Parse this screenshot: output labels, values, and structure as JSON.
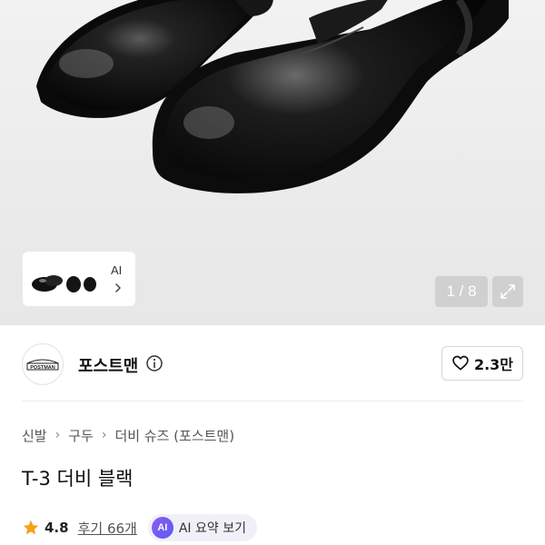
{
  "gallery": {
    "image_alt": "black derby shoes",
    "thumbnail_tag": "AI",
    "pager": "1 / 8"
  },
  "brand": {
    "name": "포스트맨",
    "logo_text": "POSTMAN",
    "likes": "2.3만"
  },
  "breadcrumb": [
    "신발",
    "구두",
    "더비 슈즈 (포스트맨)"
  ],
  "product": {
    "title": "T-3 더비 블랙",
    "rating": "4.8",
    "review_label": "후기 66개",
    "ai_badge": "AI",
    "ai_summary_label": "AI 요약 보기"
  },
  "colors": {
    "star": "#f4a21a",
    "ai_accent": "#6d5cf2"
  }
}
